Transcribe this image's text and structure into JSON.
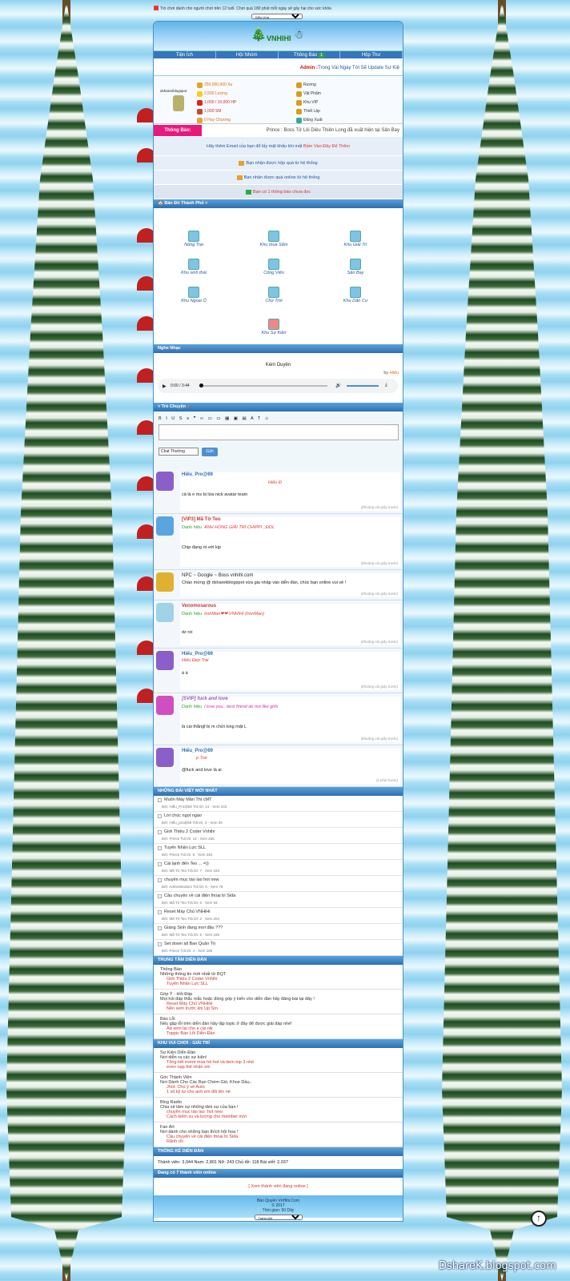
{
  "topbar": {
    "warning": "Trò chơi dành cho người chơi trên 12 tuổi. Chơi quá 180 phút mỗi ngày sẽ gây hại cho sức khỏe.",
    "style_select": "Kiểu Ứng"
  },
  "nav": {
    "items": [
      "Tiện Ích",
      "Hội Nhóm",
      "Thông Báo",
      "Hộp Thư"
    ],
    "badge": "1"
  },
  "admin": {
    "name": "Admin :",
    "text": "Trong Vài Ngày Tới Sẽ Update Sự Kiệ"
  },
  "user": {
    "name": "dsharenblogspot",
    "xu": "250,000,000 Xu",
    "luong": "2,500 Lượng",
    "hp": "1,000 / 10,000 HP",
    "sm": "1,000 SM",
    "huy": "0 Huy Chương",
    "menu": [
      "Rương",
      "Vật Phẩm",
      "Khu VIP",
      "Thiết Lập",
      "Đăng Xuất"
    ]
  },
  "notice": {
    "label": "Thông Báo:",
    "text": "Prince : Boss Tử Lôi Diêu Thiên Long đã xuất hiện tại Sân Bay"
  },
  "infos": {
    "email_a": "Hãy thêm Email của bạn để lấy mật khẩu khi mất",
    "email_b": "Bấm Vào Đây Để Thêm",
    "gift1": "Bạn nhận được hộp quà từ hệ thống",
    "gift2": "Bạn nhận được quà online từ hệ thống",
    "mail": "Bạn có 1 thông báo chưa đọc"
  },
  "map": {
    "title": "Bản Đồ Thành Phố",
    "locations": [
      "Nông Trại",
      "Khu mua Sắm",
      "Khu Giải Trí",
      "Khu sinh thái",
      "Công Viên",
      "Sân Bay",
      "Khu Ngoại Ô",
      "Chợ Trời",
      "Khu Dân Cư",
      "Khu Sự Kiện"
    ]
  },
  "music": {
    "title": "Nghe Nhạc",
    "song": "Kém Duyên",
    "by": "by",
    "artist": "Hiếu",
    "time": "0:00 / 3:44"
  },
  "chat": {
    "title": "Trò Chuyện",
    "tools": "B I U S ≡ ❞ ∞ ▭ ▭ ▦ ▣ ▤ A T ☺",
    "mode": "Chat Thường",
    "send": "Gửi"
  },
  "messages": [
    {
      "name": "Hiếu_Pro@69",
      "extra": "Hiếu Đ",
      "title": "",
      "text": "cả là e ms bị lừa nick avatar team",
      "time": "(khoảng vài giây trước)"
    },
    {
      "name": "[VIP3] Mã Tờ Teo",
      "extra": "ANH HÙNG GIẢI TRÍ CHIPPI _ĐOL",
      "title": "Danh hiệu",
      "text": "Chịp đang nt với kịp",
      "time": "(khoảng vài giây trước)"
    },
    {
      "name": "NPC ~ Google ~ Boss vnhihi.com",
      "extra": "",
      "title": "",
      "text": "Chào mừng @ dsharekblogspot vừa gia nhập vào diễn đàn, chúc bạn online vui vẻ !",
      "time": "(khoảng vài giây trước)"
    },
    {
      "name": "Venomosarous",
      "extra": "IronMan❤❤ VNHIHI (IronMan)",
      "title": "Danh hiệu",
      "text": "dz roi",
      "time": "(khoảng vài giây trước)"
    },
    {
      "name": "Hiếu_Pro@69",
      "extra": "Hiếu Đẹp Trai",
      "title": "",
      "text": "à à",
      "time": "(khoảng vài giây trước)"
    },
    {
      "name": "[SVIP] fuck and love",
      "extra": "I love you.. best friend do mơ like girls",
      "title": "Danh hiệu",
      "text": "là cái thằngf bị m chửi long mặt L",
      "time": "(khoảng vài giây trước)"
    },
    {
      "name": "Hiếu_Pro@69",
      "extra": "p Trai",
      "title": "",
      "text": "@fuck and love là ai",
      "time": "(1 phút trước)"
    }
  ],
  "posts": {
    "title": "NHỮNG BÀI VIẾT MỚI NHẤT",
    "items": [
      {
        "t": "Muốn Máy Mần Thì cMT",
        "m": "Bởi: Hiếu_Pro@69 Trả lời: 14 - Xem 243"
      },
      {
        "t": "Lời chúc ngọt ngào",
        "m": "Bởi: Hiếu_pro@69 Trả lời: 3 - Xem 39"
      },
      {
        "t": "Giới Thiệu 2 Coder Vnhihi",
        "m": "Bởi: Prince Trả lời: 12 - Xem 255"
      },
      {
        "t": "Tuyển Nhân Lực SLL",
        "m": "Bởi: Prince Trả lời: 9 - Xem 246"
      },
      {
        "t": "Cái lạnh đến Teo ... =))",
        "m": "Bởi: Mã Tờ Teo Trả lời: 7 - Xem 183"
      },
      {
        "t": "chuyên mục tào lao hot new",
        "m": "Bởi: Administrators Trả lời: 6 - Xem 78"
      },
      {
        "t": "Câu chuyện về cái điện thoại bí Sida",
        "m": "Bởi: Mã Tờ Teo Trả lời: 6 - Xem 93"
      },
      {
        "t": "Reset Máy Chủ VNHiHi",
        "m": "Bởi: Mã Tờ Teo Trả lời: 2 - Xem 204"
      },
      {
        "t": "Giáng Sinh đang mơi đâu ???",
        "m": "Bởi: Mã Tờ Teo Trả lời: 5 - Xem 226"
      },
      {
        "t": "Set down all Ban Quản Trị",
        "m": "Bởi: Prince Trả lời: 4 - Xem 166"
      }
    ]
  },
  "center": {
    "title": "TRUNG TÂM DIỄN ĐÀN",
    "groups": [
      {
        "h": "Thông Báo",
        "d": "Những thông tin mới nhất từ BQT",
        "l": [
          "Giới Thiệu 2 Coder Vnhihi",
          "Tuyển Nhân Lực SLL"
        ]
      },
      {
        "h": "Góp Ý - Hỏi Đáp",
        "d": "Mọi hỏi đáp thắc mắc hoặc đóng góp ý kiến cho diễn đàn hãy đăng bài tại đây !",
        "l": [
          "Reset Máy Chủ VNHiHi",
          "Nên xem trước khi Up Sm"
        ]
      },
      {
        "h": "Báo Lỗi",
        "d": "Nếu gặp lỗi trên diễn đàn hãy lập topic ở đây để được giải đáp nhé!",
        "l": [
          "Ad xem lại cho e cái nik",
          "Toppic Báo Lỗi Diễn Đàn"
        ]
      }
    ]
  },
  "fun": {
    "title": "KHU VUI CHƠI - GIẢI TRÍ",
    "groups": [
      {
        "h": "Sự Kiện Diễn Đàn",
        "d": "Nơi diễn ra các sự kiện!",
        "l": [
          "Tổng kết event mùa hè:hot và item top 3 nhé",
          "even nạp thẻ nhận sm"
        ]
      },
      {
        "h": "Góc Thành Viên",
        "d": "Nơi Dành Cho Các Bạn Chém Gió, Khoe Dầu..",
        "l": [
          "Jhot: Chú ý về Auto",
          "1 số kỹ tự cho anh em đối lên nè"
        ]
      },
      {
        "h": "Blog Radio",
        "d": "Chia sẻ tâm sự những tâm sự của bạn !",
        "l": [
          "chuyên mục tào lao :hot new",
          "Cách kiếm xu và lượng cho member mới"
        ]
      },
      {
        "h": "Fan Art",
        "d": "Nơi dành cho những bạn thích hội họa !",
        "l": [
          "Câu chuyện về cái điện thoại bí Sida",
          "Rảnh rỗi"
        ]
      }
    ]
  },
  "stats": {
    "title": "THỐNG KÊ DIỄN ĐÀN",
    "text": "Thành viên: 3,044 Nam: 2,801 Nữ: 243 Chủ đề: 118 Bài viết: 2,037"
  },
  "online": {
    "title": "Đang có 7 thành viên online",
    "link": "[ Xem thành viên đang online ]"
  },
  "footer": {
    "copy": "Bản Quyền VnHihi.Com",
    "year": "© 2017",
    "time": "Thời gian: 50 Dây",
    "select": "Trang chủ"
  },
  "watermark": "DshareK.blogspot.com"
}
